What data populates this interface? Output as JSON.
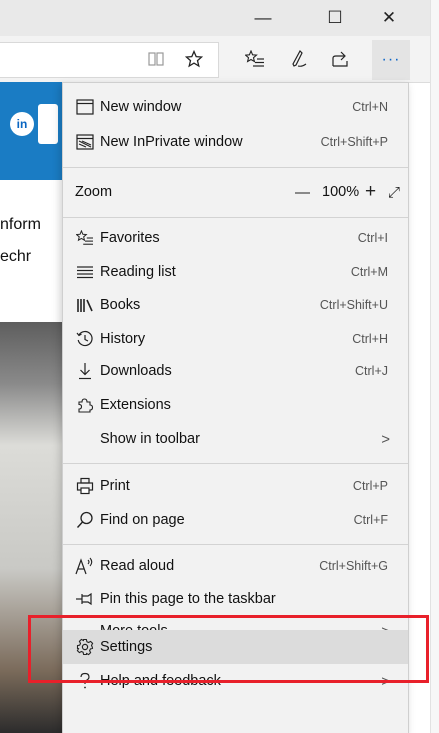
{
  "window_controls": {
    "minimize": "—",
    "maximize": "☐",
    "close": "✕"
  },
  "toolbar": {
    "reading_view_icon": "book-icon",
    "favorite_star_icon": "star-icon",
    "favorites_icon": "favorites-list-icon",
    "notes_icon": "pen-icon",
    "share_icon": "share-icon",
    "more_label": "···"
  },
  "page_fragments": {
    "line1": "nform",
    "line2": "echr"
  },
  "menu": {
    "new_window": {
      "label": "New window",
      "shortcut": "Ctrl+N"
    },
    "new_inprivate": {
      "label": "New InPrivate window",
      "shortcut": "Ctrl+Shift+P"
    },
    "zoom": {
      "label": "Zoom",
      "minus": "—",
      "level": "100%",
      "plus": "+",
      "fullscreen": "⤢"
    },
    "favorites": {
      "label": "Favorites",
      "shortcut": "Ctrl+I"
    },
    "reading_list": {
      "label": "Reading list",
      "shortcut": "Ctrl+M"
    },
    "books": {
      "label": "Books",
      "shortcut": "Ctrl+Shift+U"
    },
    "history": {
      "label": "History",
      "shortcut": "Ctrl+H"
    },
    "downloads": {
      "label": "Downloads",
      "shortcut": "Ctrl+J"
    },
    "extensions": {
      "label": "Extensions"
    },
    "show_in_toolbar": {
      "label": "Show in toolbar",
      "chevron": ">"
    },
    "print": {
      "label": "Print",
      "shortcut": "Ctrl+P"
    },
    "find_on_page": {
      "label": "Find on page",
      "shortcut": "Ctrl+F"
    },
    "read_aloud": {
      "label": "Read aloud",
      "shortcut": "Ctrl+Shift+G"
    },
    "pin_taskbar": {
      "label": "Pin this page to the taskbar"
    },
    "more_tools": {
      "label": "More tools",
      "chevron": ">"
    },
    "settings": {
      "label": "Settings"
    },
    "help_feedback": {
      "label": "Help and feedback",
      "chevron": ">"
    }
  },
  "colors": {
    "highlight_box": "#e8202a",
    "linkedin_blue": "#0a66c2",
    "accent_blue": "#0a64c8"
  }
}
